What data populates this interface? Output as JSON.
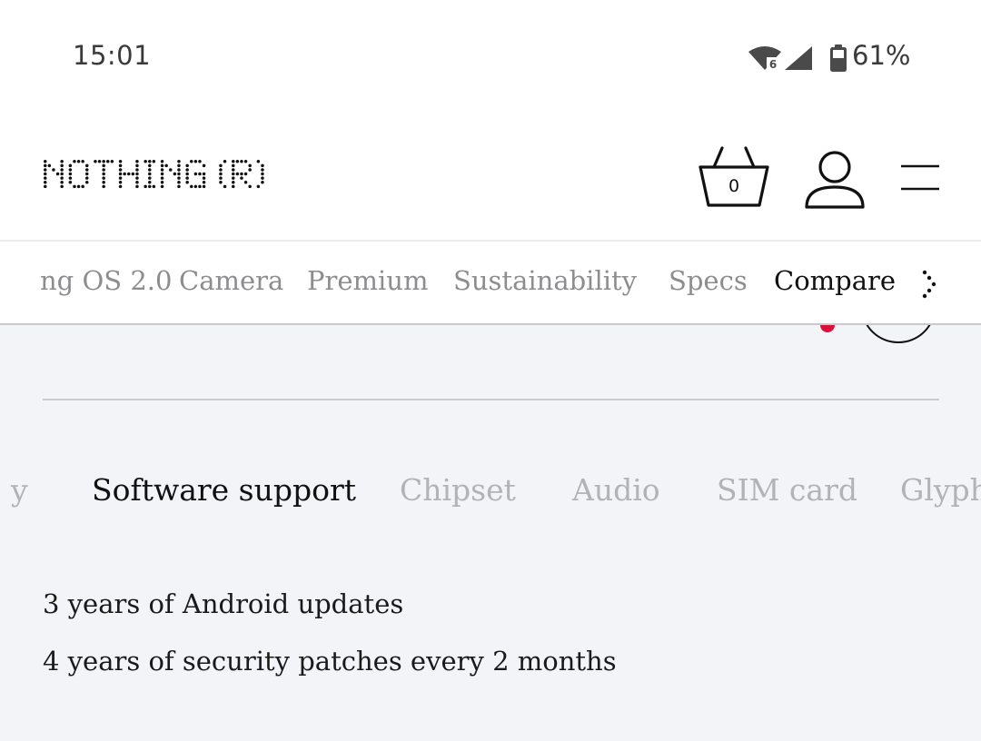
{
  "status_bar": {
    "time": "15:01",
    "battery_percent": "61%",
    "wifi_badge": "6",
    "icons": [
      "wifi-icon",
      "cell-signal-icon",
      "battery-icon"
    ]
  },
  "header": {
    "logo_text": "NOTHING (R)",
    "basket_count": "0",
    "icons": [
      "basket-icon",
      "account-icon",
      "menu-icon"
    ]
  },
  "section_nav": {
    "items": [
      {
        "label": "ng OS 2.0",
        "active": false
      },
      {
        "label": "Camera",
        "active": false
      },
      {
        "label": "Premium",
        "active": false
      },
      {
        "label": "Sustainability",
        "active": false
      },
      {
        "label": "Specs",
        "active": false
      },
      {
        "label": "Compare",
        "active": true
      }
    ],
    "more_icon": "chevron-right-dotted-icon"
  },
  "spec_tabs": {
    "items": [
      {
        "label": "y",
        "active": false
      },
      {
        "label": "Software support",
        "active": true
      },
      {
        "label": "Chipset",
        "active": false
      },
      {
        "label": "Audio",
        "active": false
      },
      {
        "label": "SIM card",
        "active": false
      },
      {
        "label": "Glyph",
        "active": false
      }
    ]
  },
  "spec_content": {
    "lines": [
      "3 years of Android updates",
      "4 years of security patches every 2 months"
    ]
  },
  "colors": {
    "accent_dot": "#d8113a",
    "content_background": "#f3f4f7",
    "inactive_nav_text": "#8d8d8f",
    "inactive_tab_text": "#b3b3b6"
  }
}
